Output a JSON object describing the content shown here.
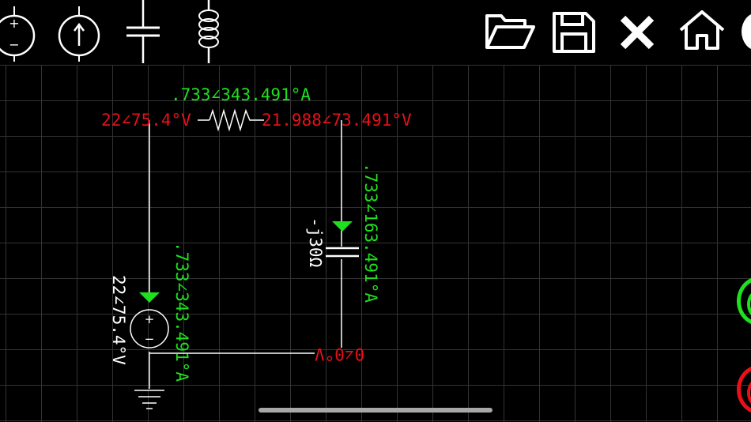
{
  "toolbar": {
    "tools": [
      {
        "name": "voltage-source-tool",
        "label": "+ −"
      },
      {
        "name": "current-source-tool"
      },
      {
        "name": "capacitor-tool"
      },
      {
        "name": "inductor-tool"
      }
    ],
    "actions": [
      {
        "name": "open-folder-icon"
      },
      {
        "name": "save-icon"
      },
      {
        "name": "close-icon"
      },
      {
        "name": "home-icon"
      }
    ]
  },
  "circuit": {
    "node_left_voltage": "22∠75.4°V",
    "node_right_voltage": "21.988∠73.491°V",
    "ground_node_voltage": "0∠0°V",
    "resistor_current": ".733∠343.491°A",
    "capacitor_current": ".733∠163.491°A",
    "capacitor_impedance": "-j30Ω",
    "source_current": ".733∠343.491°A",
    "source_voltage": "22∠75.4°V"
  },
  "colors": {
    "voltage": "#e8101a",
    "current": "#1fe01f",
    "wire": "#ffffff",
    "grid": "#333333",
    "run_button": "#1fe01f",
    "stop_button": "#e8101a"
  }
}
